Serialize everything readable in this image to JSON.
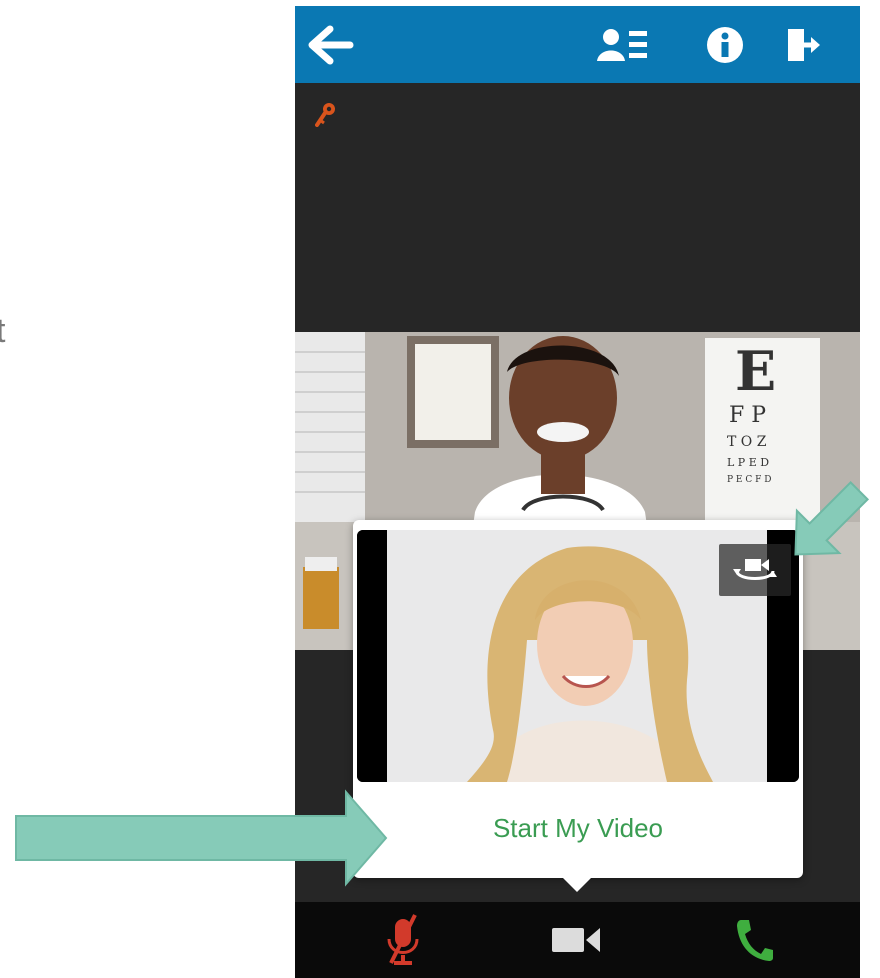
{
  "page": {
    "cut_text": "t"
  },
  "header": {
    "back_icon": "arrow-left-icon",
    "participants_icon": "participants-list-icon",
    "info_icon": "info-icon",
    "exit_icon": "exit-door-icon"
  },
  "session": {
    "lock_icon": "key-icon"
  },
  "self_view": {
    "action_label": "Start My Video",
    "switch_camera_icon": "switch-camera-icon"
  },
  "controls": {
    "mic_icon": "microphone-muted-icon",
    "camera_icon": "video-camera-icon",
    "call_icon": "phone-icon"
  },
  "colors": {
    "header_bg": "#0a78b3",
    "accent_orange": "#d9541c",
    "start_video_text": "#3a9c52",
    "call_green": "#3fae3f",
    "mic_red": "#d23a2b",
    "callout_arrow": "#86cbb8"
  }
}
